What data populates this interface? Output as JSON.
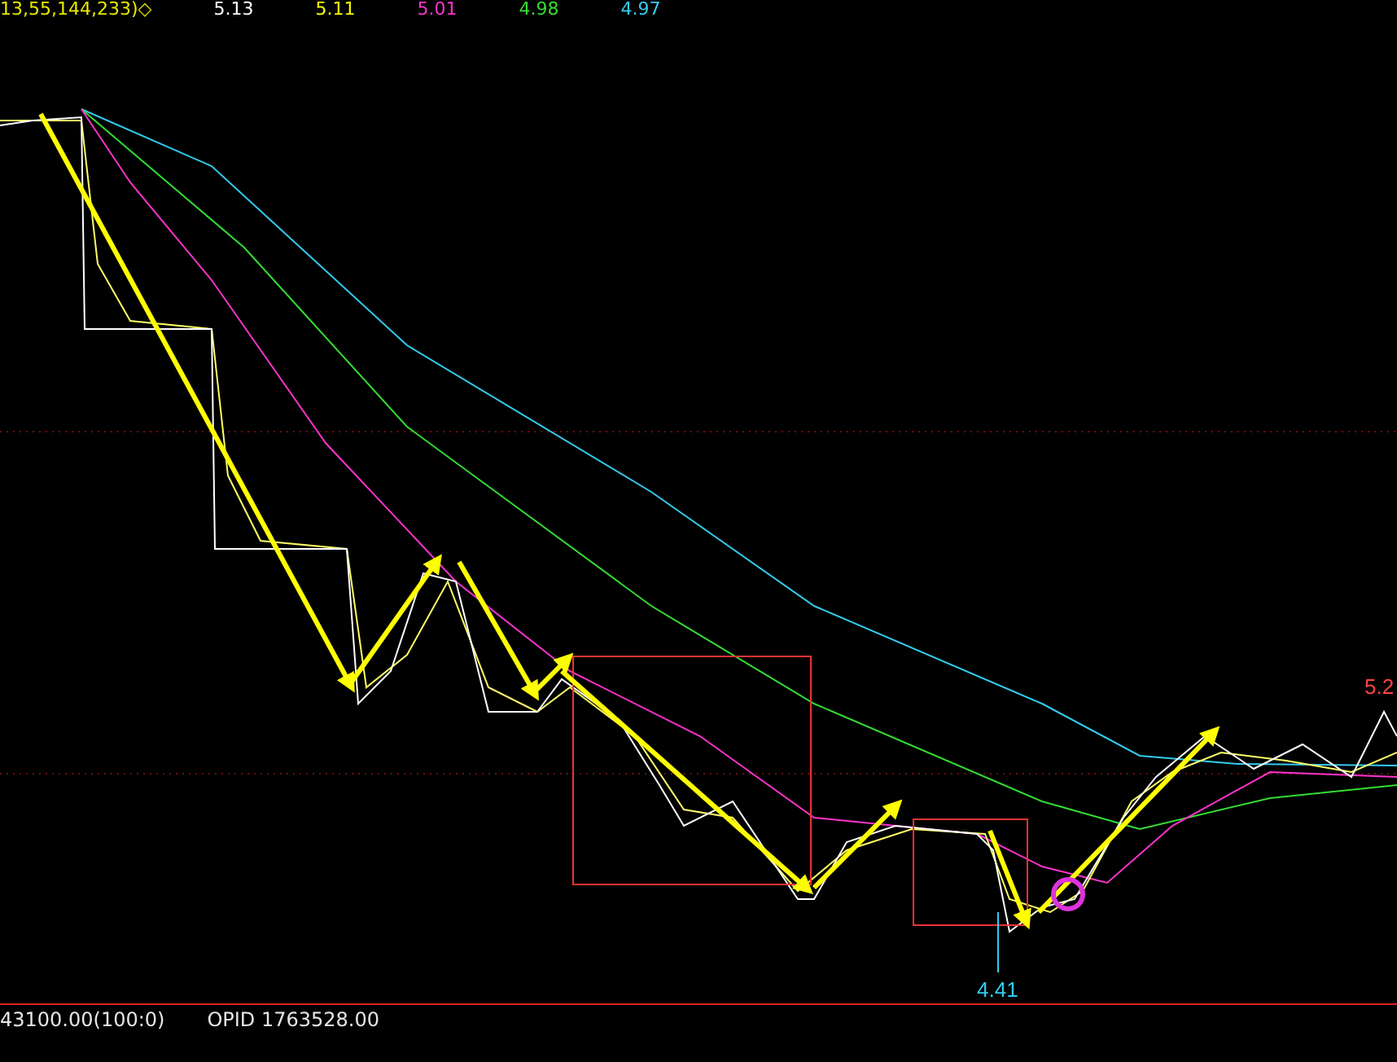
{
  "legend": [
    {
      "text": "13,55,144,233)◇",
      "color": "#e8e800"
    },
    {
      "text": "5.13",
      "color": "#ffffff"
    },
    {
      "text": "5.11",
      "color": "#ffff00"
    },
    {
      "text": "5.01",
      "color": "#ff33cc"
    },
    {
      "text": "4.98",
      "color": "#33dd33"
    },
    {
      "text": "4.97",
      "color": "#33ccee"
    }
  ],
  "chart": {
    "high_label": "5.2",
    "low_label": "4.41"
  },
  "footer": {
    "volume": "43100.00(100:0)",
    "opid": "OPID 1763528.00"
  }
}
